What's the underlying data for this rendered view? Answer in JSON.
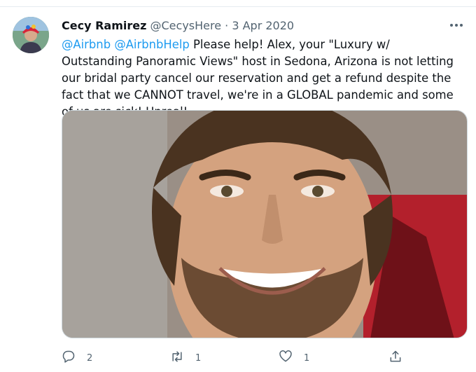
{
  "tweet": {
    "display_name": "Cecy Ramirez",
    "handle": "@CecysHere",
    "separator": "·",
    "date": "3 Apr 2020",
    "text_parts": {
      "mention1": "@Airbnb",
      "mention2": "@AirbnbHelp",
      "body": "Please help! Alex, your \"Luxury w/ Outstanding Panoramic Views\" host in Sedona, Arizona is not letting our bridal party cancel our reservation and get a refund despite the fact that we CANNOT travel, we're in a GLOBAL pandemic and some of us are sick! Unreal!"
    },
    "actions": {
      "reply_count": "2",
      "retweet_count": "1",
      "like_count": "1"
    },
    "icons": {
      "more": "more-icon",
      "reply": "reply-icon",
      "retweet": "retweet-icon",
      "like": "heart-icon",
      "share": "share-icon"
    },
    "colors": {
      "mention": "#1d9bf0",
      "secondary_text": "#536471"
    }
  }
}
